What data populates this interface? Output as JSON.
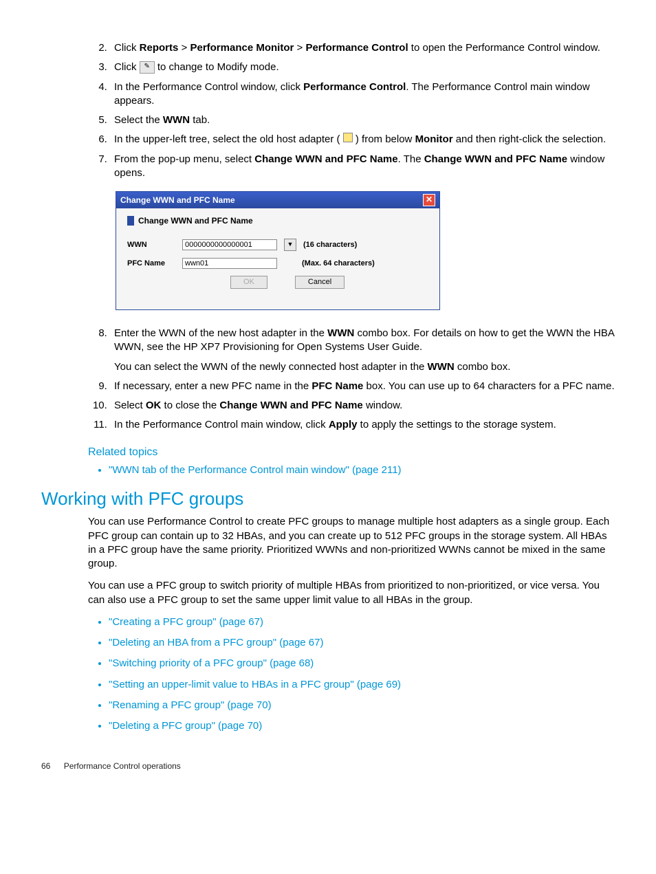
{
  "steps": {
    "s2a": "Click ",
    "s2b1": "Reports",
    "s2gt1": " > ",
    "s2b2": "Performance Monitor",
    "s2gt2": " > ",
    "s2b3": "Performance Control",
    "s2c": " to open the Performance Control window.",
    "s3a": "Click ",
    "s3b": " to change to Modify mode.",
    "s4a": "In the Performance Control window, click ",
    "s4b": "Performance Control",
    "s4c": ". The Performance Control main window appears.",
    "s5a": "Select the ",
    "s5b": "WWN",
    "s5c": " tab.",
    "s6a": "In the upper-left tree, select the old host adapter ( ",
    "s6b": " ) from below ",
    "s6c": "Monitor",
    "s6d": " and then right-click the selection.",
    "s7a": "From the pop-up menu, select ",
    "s7b": "Change WWN and PFC Name",
    "s7c": ". The ",
    "s7d": "Change WWN and PFC Name",
    "s7e": " window opens.",
    "s8a": "Enter the WWN of the new host adapter in the ",
    "s8b": "WWN",
    "s8c": " combo box. For details on how to get the WWN the HBA WWN, see the HP XP7 Provisioning for Open Systems User Guide.",
    "s8d": "You can select the WWN of the newly connected host adapter in the ",
    "s8e": "WWN",
    "s8f": " combo box.",
    "s9a": "If necessary, enter a new PFC name in the ",
    "s9b": "PFC Name",
    "s9c": " box. You can use up to 64 characters for a PFC name.",
    "s10a": "Select ",
    "s10b": "OK",
    "s10c": " to close the ",
    "s10d": "Change WWN and PFC Name",
    "s10e": " window.",
    "s11a": "In the Performance Control main window, click ",
    "s11b": "Apply",
    "s11c": " to apply the settings to the storage system."
  },
  "dialog": {
    "title": "Change WWN and PFC Name",
    "subtitle": "Change WWN and PFC Name",
    "wwn_label": "WWN",
    "wwn_value": "0000000000000001",
    "wwn_hint": "(16 characters)",
    "pfc_label": "PFC Name",
    "pfc_value": "wwn01",
    "pfc_hint": "(Max. 64 characters)",
    "ok": "OK",
    "cancel": "Cancel"
  },
  "related": {
    "heading": "Related topics",
    "item1": "\"WWN tab of the Performance Control main window\" (page 211)"
  },
  "section": {
    "heading": "Working with PFC groups",
    "p1": "You can use Performance Control to create PFC groups to manage multiple host adapters as a single group. Each PFC group can contain up to 32 HBAs, and you can create up to 512 PFC groups in the storage system. All HBAs in a PFC group have the same priority. Prioritized WWNs and non-prioritized WWNs cannot be mixed in the same group.",
    "p2": "You can use a PFC group to switch priority of multiple HBAs from prioritized to non-prioritized, or vice versa. You can also use a PFC group to set the same upper limit value to all HBAs in the group.",
    "links": {
      "l1": "\"Creating a PFC group\" (page 67)",
      "l2": "\"Deleting an HBA from a PFC group\" (page 67)",
      "l3": "\"Switching priority of a PFC group\" (page 68)",
      "l4": "\"Setting an upper-limit value to HBAs in a PFC group\" (page 69)",
      "l5": "\"Renaming a PFC group\" (page 70)",
      "l6": "\"Deleting a PFC group\" (page 70)"
    }
  },
  "footer": {
    "page": "66",
    "title": "Performance Control operations"
  }
}
